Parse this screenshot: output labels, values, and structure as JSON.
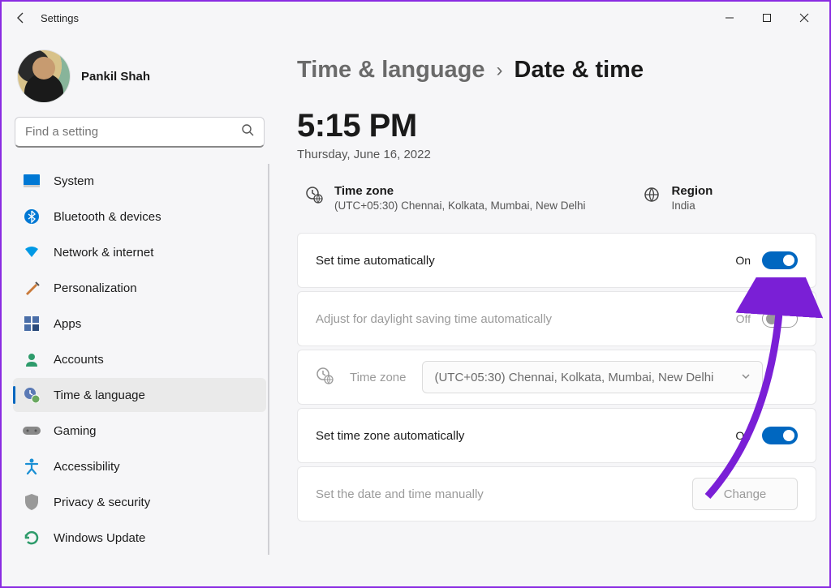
{
  "window": {
    "title": "Settings"
  },
  "user": {
    "name": "Pankil Shah"
  },
  "search": {
    "placeholder": "Find a setting"
  },
  "nav": {
    "items": [
      {
        "label": "System"
      },
      {
        "label": "Bluetooth & devices"
      },
      {
        "label": "Network & internet"
      },
      {
        "label": "Personalization"
      },
      {
        "label": "Apps"
      },
      {
        "label": "Accounts"
      },
      {
        "label": "Time & language"
      },
      {
        "label": "Gaming"
      },
      {
        "label": "Accessibility"
      },
      {
        "label": "Privacy & security"
      },
      {
        "label": "Windows Update"
      }
    ],
    "active_index": 6
  },
  "breadcrumb": {
    "parent": "Time & language",
    "current": "Date & time"
  },
  "clock": {
    "time": "5:15 PM",
    "date": "Thursday, June 16, 2022"
  },
  "timezone_info": {
    "label": "Time zone",
    "value": "(UTC+05:30) Chennai, Kolkata, Mumbai, New Delhi"
  },
  "region_info": {
    "label": "Region",
    "value": "India"
  },
  "settings": {
    "set_time_auto": {
      "label": "Set time automatically",
      "state": "On",
      "on": true
    },
    "dst_auto": {
      "label": "Adjust for daylight saving time automatically",
      "state": "Off",
      "on": false
    },
    "timezone_select": {
      "label": "Time zone",
      "value": "(UTC+05:30) Chennai, Kolkata, Mumbai, New Delhi"
    },
    "set_tz_auto": {
      "label": "Set time zone automatically",
      "state": "On",
      "on": true
    },
    "manual": {
      "label": "Set the date and time manually",
      "button": "Change"
    }
  }
}
